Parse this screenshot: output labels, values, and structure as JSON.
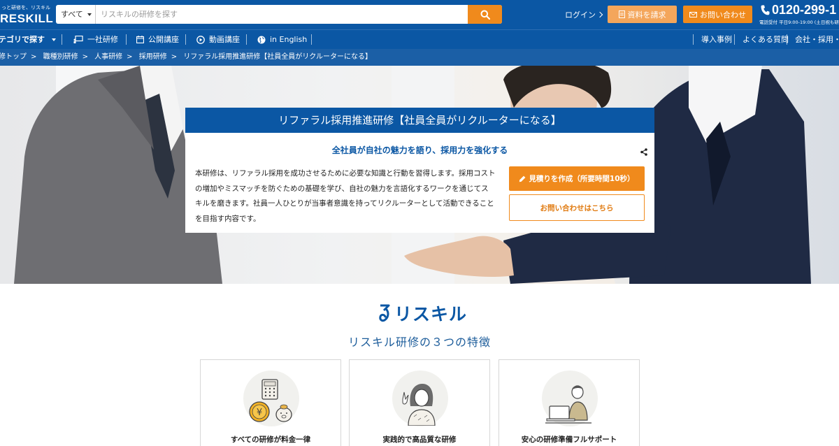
{
  "header": {
    "logo_tagline": "っと研修を、リスキル",
    "logo_name": "RESKILL",
    "search": {
      "category": "すべて",
      "placeholder": "リスキルの研修を探す"
    },
    "login": "ログイン",
    "request_docs": "資料を請求",
    "contact": "お問い合わせ",
    "phone": "0120-299-1",
    "phone_hours": "電話受付 平日9:00-19:00 (土日祝も研"
  },
  "nav": {
    "category": "テゴリで探す",
    "items": [
      "一社研修",
      "公開講座",
      "動画講座",
      "in English"
    ],
    "right": [
      "導入事例",
      "よくある質問",
      "会社・採用・IR"
    ]
  },
  "breadcrumb": [
    "修トップ",
    "職種別研修",
    "人事研修",
    "採用研修",
    "リファラル採用推進研修【社員全員がリクルーターになる】"
  ],
  "hero": {
    "title": "リファラル採用推進研修【社員全員がリクルーターになる】",
    "subtitle": "全社員が自社の魅力を語り、採用力を強化する",
    "description": "本研修は、リファラル採用を成功させるために必要な知識と行動を習得します。採用コストの増加やミスマッチを防ぐための基礎を学び、自社の魅力を言語化するワークを通じてスキルを磨きます。社員一人ひとりが当事者意識を持ってリクルーターとして活動できることを目指す内容です。",
    "quote_button": "見積りを作成（所要時間10秒）",
    "inquiry_button": "お問い合わせはこちら"
  },
  "features": {
    "brand": "リスキル",
    "title": "リスキル研修の３つの特徴",
    "cards": [
      {
        "label": "すべての研修が料金一律",
        "icon": "calculator-coins-icon"
      },
      {
        "label": "実践的で高品質な研修",
        "icon": "instructor-icon"
      },
      {
        "label": "安心の研修準備フルサポート",
        "icon": "support-staff-icon"
      }
    ]
  },
  "colors": {
    "primary": "#0b57a4",
    "accent": "#f08a1c"
  }
}
